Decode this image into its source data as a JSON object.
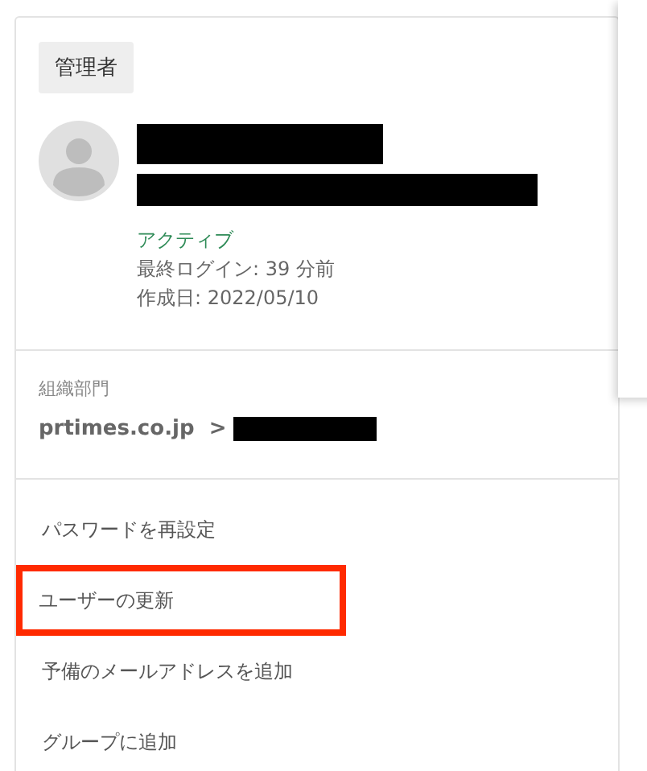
{
  "role_badge": "管理者",
  "user": {
    "status": "アクティブ",
    "last_login": "最終ログイン: 39 分前",
    "created": "作成日: 2022/05/10"
  },
  "org_unit": {
    "label": "組織部門",
    "path": "prtimes.co.jp  >"
  },
  "actions": [
    {
      "label": "パスワードを再設定",
      "highlighted": false
    },
    {
      "label": "ユーザーの更新",
      "highlighted": true
    },
    {
      "label": "予備のメールアドレスを追加",
      "highlighted": false
    },
    {
      "label": "グループに追加",
      "highlighted": false
    }
  ]
}
